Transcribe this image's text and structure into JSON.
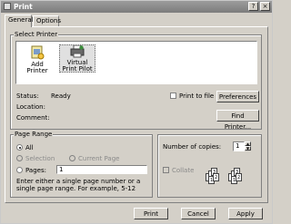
{
  "window": {
    "title": "Print",
    "help_label": "?",
    "close_label": "×"
  },
  "tabs": [
    {
      "label": "General"
    },
    {
      "label": "Options"
    }
  ],
  "select_printer": {
    "title": "Select Printer",
    "printers": [
      {
        "label": "Add Printer",
        "icon": "add-printer-icon"
      },
      {
        "label": "Virtual Print Pilot",
        "icon": "printer-icon",
        "selected": true
      }
    ],
    "status_label": "Status:",
    "status_value": "Ready",
    "location_label": "Location:",
    "location_value": "",
    "comment_label": "Comment:",
    "comment_value": "",
    "print_to_file_label": "Print to file",
    "preferences_label": "Preferences",
    "find_printer_label": "Find Printer..."
  },
  "page_range": {
    "title": "Page Range",
    "all_label": "All",
    "selection_label": "Selection",
    "current_page_label": "Current Page",
    "pages_label": "Pages:",
    "pages_value": "1",
    "hint": "Enter either a single page number or a single page range.  For example, 5-12"
  },
  "copies": {
    "number_label": "Number of copies:",
    "number_value": "1",
    "collate_label": "Collate",
    "collate_pages": [
      "1",
      "2",
      "3"
    ]
  },
  "buttons": {
    "print": "Print",
    "cancel": "Cancel",
    "apply": "Apply"
  }
}
